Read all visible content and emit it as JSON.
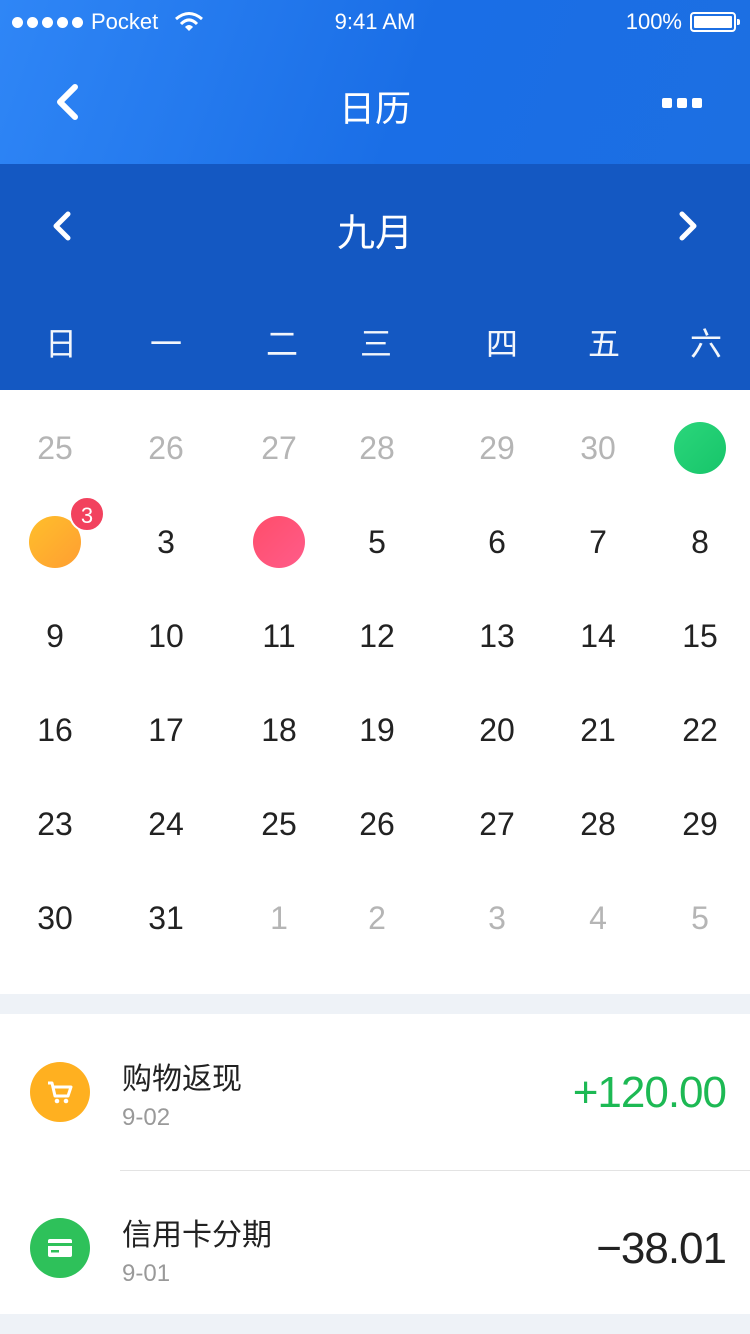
{
  "status_bar": {
    "carrier": "Pocket",
    "time": "9:41 AM",
    "battery": "100%"
  },
  "nav": {
    "title": "日历"
  },
  "month": {
    "title": "九月"
  },
  "weekdays": [
    "日",
    "一",
    "二",
    "三",
    "四",
    "五",
    "六"
  ],
  "calendar": {
    "weeks": [
      [
        {
          "label": "25",
          "muted": true
        },
        {
          "label": "26",
          "muted": true
        },
        {
          "label": "27",
          "muted": true
        },
        {
          "label": "28",
          "muted": true
        },
        {
          "label": "29",
          "muted": true
        },
        {
          "label": "30",
          "muted": true
        },
        {
          "label": "",
          "marker": "green"
        }
      ],
      [
        {
          "label": "",
          "marker": "orange",
          "badge": "3"
        },
        {
          "label": "3"
        },
        {
          "label": "",
          "marker": "red"
        },
        {
          "label": "5"
        },
        {
          "label": "6"
        },
        {
          "label": "7"
        },
        {
          "label": "8"
        }
      ],
      [
        {
          "label": "9"
        },
        {
          "label": "10"
        },
        {
          "label": "11"
        },
        {
          "label": "12"
        },
        {
          "label": "13"
        },
        {
          "label": "14"
        },
        {
          "label": "15"
        }
      ],
      [
        {
          "label": "16"
        },
        {
          "label": "17"
        },
        {
          "label": "18"
        },
        {
          "label": "19"
        },
        {
          "label": "20"
        },
        {
          "label": "21"
        },
        {
          "label": "22"
        }
      ],
      [
        {
          "label": "23"
        },
        {
          "label": "24"
        },
        {
          "label": "25"
        },
        {
          "label": "26"
        },
        {
          "label": "27"
        },
        {
          "label": "28"
        },
        {
          "label": "29"
        }
      ],
      [
        {
          "label": "30"
        },
        {
          "label": "31"
        },
        {
          "label": "1",
          "muted": true
        },
        {
          "label": "2",
          "muted": true
        },
        {
          "label": "3",
          "muted": true
        },
        {
          "label": "4",
          "muted": true
        },
        {
          "label": "5",
          "muted": true
        }
      ]
    ]
  },
  "transactions": [
    {
      "title": "购物返现",
      "date": "9-02",
      "amount": "+120.00",
      "icon": "cart-icon",
      "icon_color": "#ffb020",
      "amount_color": "#1db954"
    },
    {
      "title": "信用卡分期",
      "date": "9-01",
      "amount": "−38.01",
      "icon": "card-icon",
      "icon_color": "#2ec15a",
      "amount_color": "#222222"
    }
  ],
  "colors": {
    "header": "#1f78ec",
    "month_band": "#1458c2",
    "green": "#1db954"
  }
}
